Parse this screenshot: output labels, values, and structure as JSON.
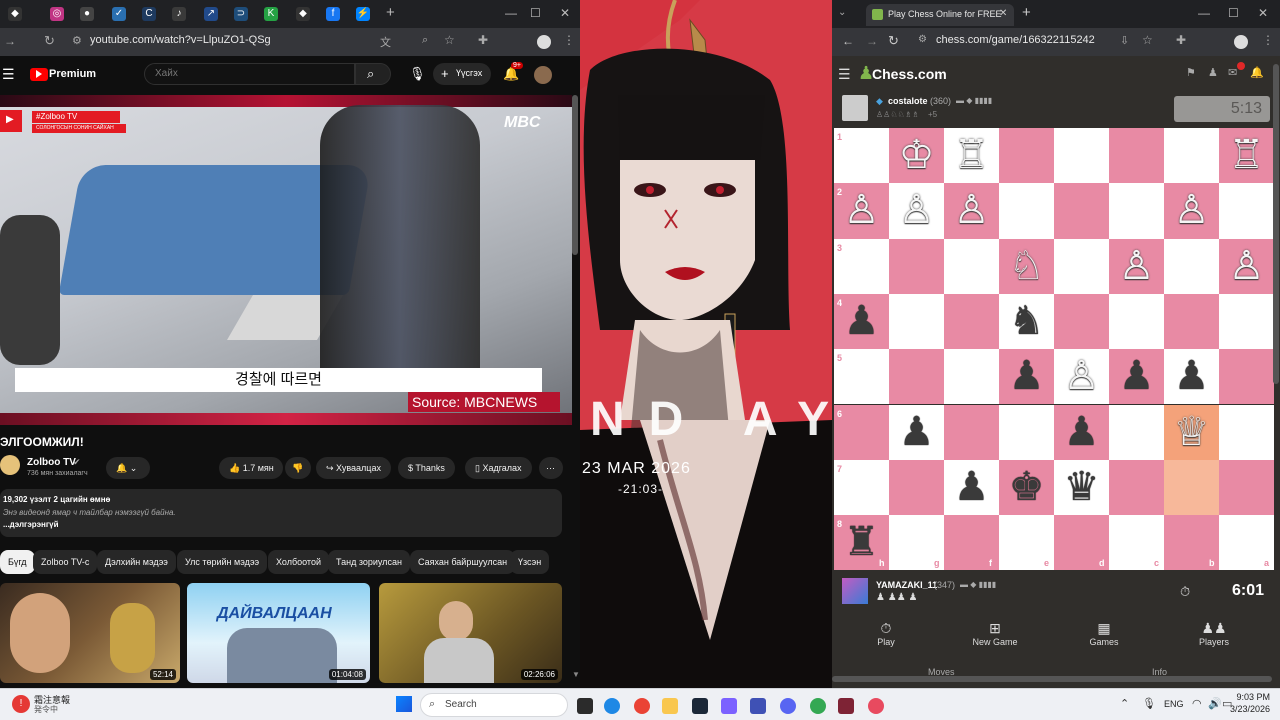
{
  "left_browser": {
    "url": "youtube.com/watch?v=LlpuZO1-QSg",
    "yt_logo": "Premium",
    "search_placeholder": "Хайх",
    "create_label": "Үүсгэх",
    "notif_badge": "9+",
    "video": {
      "channel_tag": "#Zolboo TV",
      "tag_sub": "СОЛОНГОСЫН СОНИН САЙХАН",
      "watermark": "MBC",
      "subtitle": "경찰에 따르면",
      "source": "Source: MBCNEWS"
    },
    "title": "ЭЛГООМЖИЛ!",
    "channel": {
      "name": "Zolboo TV",
      "subs": "736 мян захиалагч"
    },
    "actions": {
      "likes": "1.7 мян",
      "share": "Хуваалцах",
      "thanks": "Thanks",
      "save": "Хадгалах"
    },
    "desc": {
      "stats": "19,302 үзэлт  2 цагийн өмнө",
      "line": "Энэ видеонд ямар ч тайлбар нэмээгүй байна.",
      "more": "...дэлгэрэнгүй"
    },
    "chips": [
      "Бүгд",
      "Zolboo TV-с",
      "Дэлхийн мэдээ",
      "Улс төрийн мэдээ",
      "Холбоотой",
      "Танд зориулсан",
      "Саяхан байршуулсан",
      "Үзсэн"
    ],
    "thumbs": [
      {
        "duration": "52:14"
      },
      {
        "duration": "01:04:08",
        "text": "ДАЙВАЛЦААН"
      },
      {
        "duration": "02:26:06"
      }
    ]
  },
  "wallpaper": {
    "big_text": "ND AY",
    "date": "23 MAR 2026",
    "time": "-21:03-"
  },
  "right_browser": {
    "tab_title": "Play Chess Online for FREE",
    "url": "chess.com/game/166322115242",
    "logo": "Chess.com",
    "opponent": {
      "name": "costalote",
      "rating": "(360)",
      "extra": "+5",
      "clock": "5:13"
    },
    "player": {
      "name": "YAMAZAKI_11",
      "rating": "(347)",
      "clock": "6:01"
    },
    "ranks": [
      "1",
      "2",
      "3",
      "4",
      "5",
      "6",
      "7",
      "8"
    ],
    "files": [
      "h",
      "g",
      "f",
      "e",
      "d",
      "c",
      "b",
      "a"
    ],
    "nav": [
      "Play",
      "New Game",
      "Games",
      "Players"
    ],
    "bottom_tabs": [
      "Moves",
      "Info"
    ]
  },
  "taskbar": {
    "weather_line1": "霜注意報",
    "weather_line2": "発令中",
    "search": "Search",
    "lang": "ENG",
    "time": "9:03 PM",
    "date": "3/23/2026"
  },
  "colors": {
    "board_light": "#ffffff",
    "board_dark": "#e88aa4",
    "youtube_red": "#ff0000",
    "chess_green": "#81b64c"
  }
}
